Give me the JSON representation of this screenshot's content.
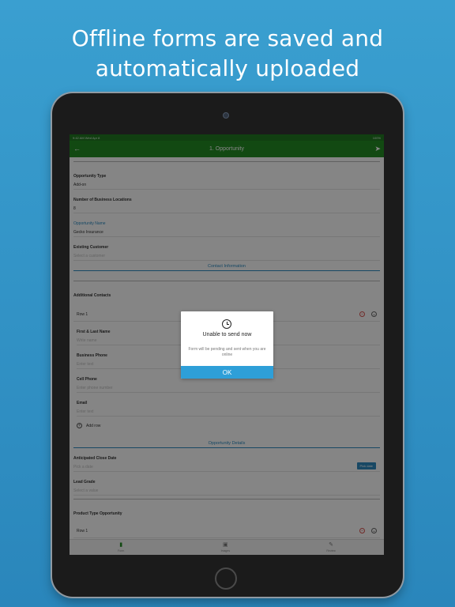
{
  "headline": {
    "line1": "Offline forms are saved and",
    "line2": "automatically uploaded"
  },
  "status_bar": {
    "left": "9:42 AM  Wed Apr 8",
    "right": "100%"
  },
  "nav": {
    "title": "1. Opportunity",
    "back_icon": "arrow-left-icon",
    "send_icon": "paper-plane-icon"
  },
  "form": {
    "opportunity_type": {
      "label": "Opportunity Type",
      "value": "Add-on"
    },
    "num_locations": {
      "label": "Number of Business Locations",
      "value": "8"
    },
    "opportunity_name": {
      "label": "Opportunity Name",
      "value": "Gecko Insurance"
    },
    "existing_customer": {
      "label": "Existing Customer",
      "placeholder": "Select a customer"
    },
    "section_contact": "Contact Information",
    "additional_contacts": {
      "label": "Additional Contacts",
      "row_label": "Row 1"
    },
    "first_last": {
      "label": "First & Last Name",
      "placeholder": "Write name"
    },
    "business_phone": {
      "label": "Business Phone",
      "placeholder": "Enter text"
    },
    "cell_phone": {
      "label": "Cell Phone",
      "placeholder": "Enter phone number"
    },
    "email": {
      "label": "Email",
      "placeholder": "Enter text"
    },
    "add_row": "Add row",
    "section_details": "Opportunity Details",
    "close_date": {
      "label": "Anticipated Close Date",
      "placeholder": "Pick a date",
      "button": "Pick date"
    },
    "lead_grade": {
      "label": "Lead Grade",
      "placeholder": "Select a value"
    },
    "product_type": {
      "label": "Product Type Opportunity",
      "row_label": "Row 1"
    }
  },
  "tabs": [
    {
      "label": "Form",
      "icon": "document-icon"
    },
    {
      "label": "Images",
      "icon": "image-icon"
    },
    {
      "label": "Review",
      "icon": "edit-icon"
    }
  ],
  "dialog": {
    "title": "Unable to send now",
    "message": "Form will be pending and sent when you are online",
    "ok_label": "OK",
    "icon": "clock-icon"
  },
  "colors": {
    "background": "#3399cc",
    "app_green": "#248c24",
    "accent_blue": "#2e8bc0",
    "ok_button": "#2e9fd8",
    "remove_red": "#d9534f"
  }
}
